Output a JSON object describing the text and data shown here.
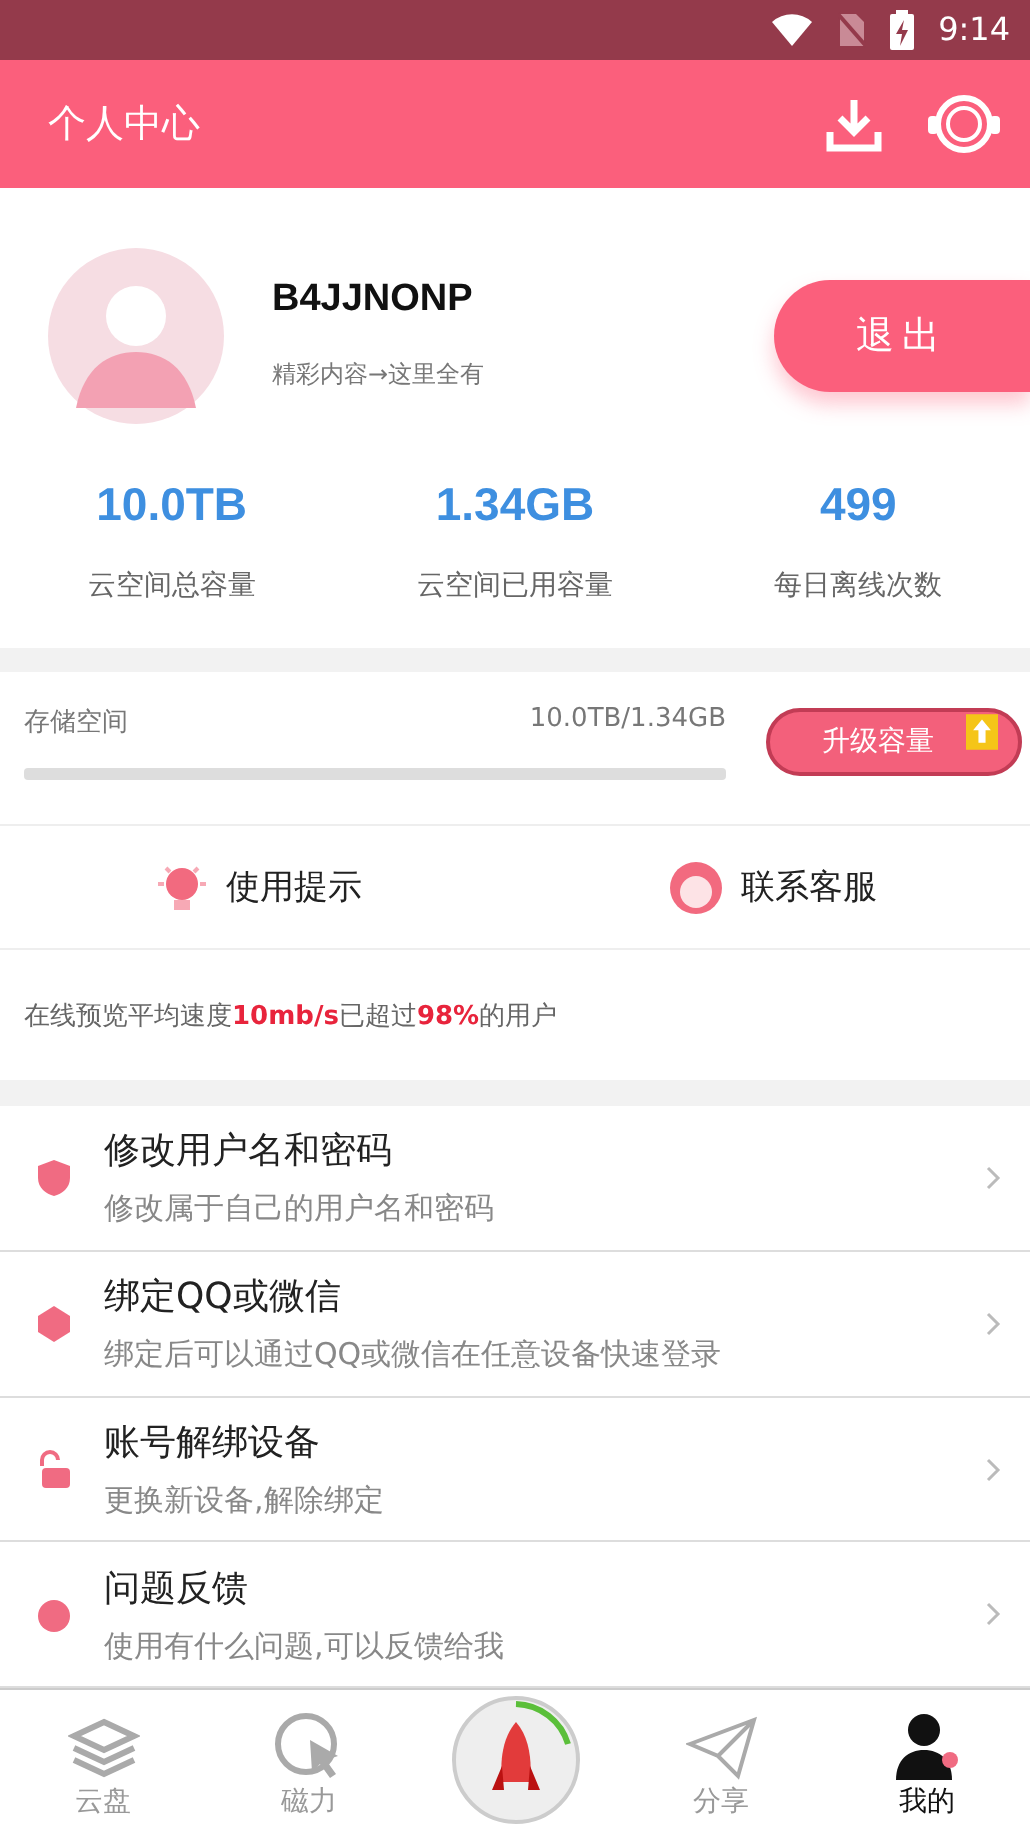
{
  "status_bar": {
    "time": "9:14"
  },
  "header": {
    "title": "个人中心"
  },
  "profile": {
    "username": "B4JJNONP",
    "tagline": "精彩内容→这里全有",
    "logout": "退出"
  },
  "stats": [
    {
      "value": "10.0TB",
      "label": "云空间总容量"
    },
    {
      "value": "1.34GB",
      "label": "云空间已用容量"
    },
    {
      "value": "499",
      "label": "每日离线次数"
    }
  ],
  "storage": {
    "label": "存储空间",
    "reading": "10.0TB/1.34GB",
    "level": 0,
    "upgrade": "升级容量"
  },
  "shortcuts": [
    {
      "kind": "tip",
      "label": "使用提示"
    },
    {
      "kind": "service",
      "label": "联系客服"
    }
  ],
  "speed_note": "在线预览平均速度**10mb/s**已超过**98%**的用户",
  "menu": [
    {
      "kind": "shield",
      "title": "修改用户名和密码",
      "subtitle": "修改属于自己的用户名和密码"
    },
    {
      "kind": "bind",
      "title": "绑定QQ或微信",
      "subtitle": "绑定后可以通过QQ或微信在任意设备快速登录"
    },
    {
      "kind": "lock",
      "title": "账号解绑设备",
      "subtitle": "更换新设备,解除绑定"
    },
    {
      "kind": "feedback",
      "title": "问题反馈",
      "subtitle": "使用有什么问题,可以反馈给我"
    }
  ],
  "tabs": [
    {
      "kind": "cloud",
      "label": "云盘",
      "selected": false
    },
    {
      "kind": "magnet",
      "label": "磁力",
      "selected": false
    },
    {
      "kind": "rocket",
      "selected": false
    },
    {
      "kind": "share",
      "label": "分享",
      "selected": false
    },
    {
      "kind": "me",
      "label": "我的",
      "selected": true
    }
  ]
}
